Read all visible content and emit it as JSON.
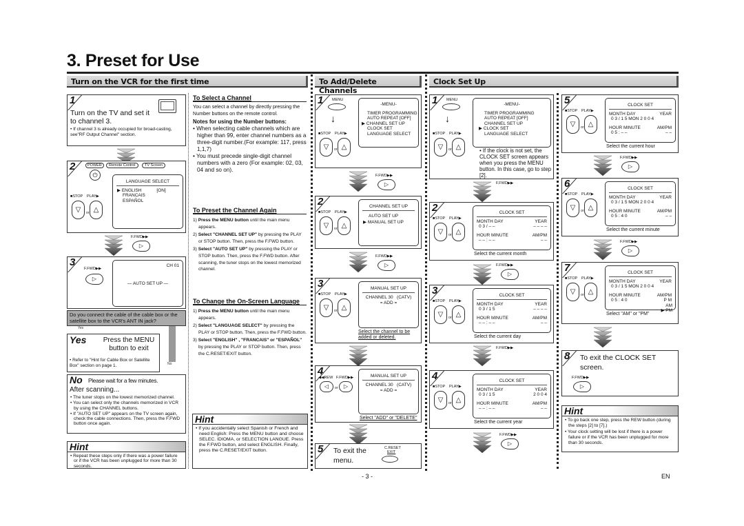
{
  "page": {
    "title": "3. Preset for Use",
    "page_number": "- 3 -",
    "language_code": "EN"
  },
  "sections": {
    "turn_on": "Turn on the VCR for the first time",
    "add_delete": "To Add/Delete Channels",
    "clock": "Clock Set Up"
  },
  "common": {
    "stop": "■STOP",
    "play": "PLAY▶",
    "or": "or",
    "ffwd": "F.FWD▶▶",
    "rew": "◀◀REW",
    "menu": "MENU",
    "hint": "Hint",
    "power": "POWER",
    "remote_control": "Remote Control",
    "tv_screen": "TV Screen",
    "creset": "C.RESET",
    "exit": "EXIT"
  },
  "turn_on": {
    "step1": {
      "num": "1",
      "text": "Turn on the TV and set it to channel 3.",
      "note": "• If channel 3 is already occupied for broad-casting, see\"RF Output Channel\" section."
    },
    "step2": {
      "num": "2",
      "screen_title": "LANGUAGE SELECT",
      "options": [
        "ENGLISH",
        "FRANCAIS",
        "ESPAÑOL"
      ],
      "option_state": "[ON]"
    },
    "step3": {
      "num": "3",
      "channel": "CH 01",
      "screen_text": "AUTO SET UP"
    },
    "question": "Do you connect the cable of the cable box or the satellite box to the VCR's ANT IN jack?",
    "yes_label": "Yes",
    "no_label": "No",
    "yes_head": "Yes",
    "yes_text": "Press the MENU button to exit",
    "yes_note": "• Refer to \"Hint for Cable Box or Satellite Box\" section on page 1.",
    "no_head": "No",
    "no_text": "Please wait for a few minutes.",
    "after": "After scanning...",
    "after_bullets": [
      "• The tuner stops on the lowest memorized channel.",
      "• You can select only the channels memorized in VCR by using the CHANNEL buttons.",
      "• If \"AUTO SET UP\" appears on the TV screen again, check the cable connections. Then, press the F.FWD button once again."
    ],
    "hint_bullets": [
      "• Repeat these steps only if there was a power failure or if the VCR has been unplugged for more than 30 seconds."
    ]
  },
  "middle": {
    "select_channel": {
      "heading": "To Select a Channel",
      "intro": "You can select a channel by directly pressing the Number buttons on the remote control.",
      "notes_heading": "Notes for using the Number buttons:",
      "bullets": [
        "• When selecting cable channels which are higher than 99, enter channel numbers as a three-digit number.(For example: 117, press 1,1,7)",
        "• You must precede single-digit channel numbers with a zero (For example: 02, 03, 04 and so on)."
      ]
    },
    "preset_again": {
      "heading": "To Preset the Channel Again",
      "items": [
        {
          "n": "1)",
          "bold": "Press the MENU button",
          "rest": " until the main menu appears."
        },
        {
          "n": "2)",
          "bold": "Select \"CHANNEL SET UP\"",
          "rest": " by pressing the PLAY or STOP button. Then, press the F.FWD button."
        },
        {
          "n": "3)",
          "bold": "Select \"AUTO SET UP\"",
          "rest": " by pressing  the PLAY or STOP button. Then, press the F.FWD button. After scanning, the tuner stops on the lowest memorized channel."
        }
      ]
    },
    "change_language": {
      "heading": "To Change the On-Screen Language",
      "items": [
        {
          "n": "1)",
          "bold": "Press the MENU button",
          "rest": " until the main menu appears."
        },
        {
          "n": "2)",
          "bold": "Select \"LANGUAGE SELECT\"",
          "rest": " by pressing the PLAY or STOP button. Then, press the F.FWD button."
        },
        {
          "n": "3)",
          "bold": "Select \"ENGLISH\" , \"FRANCAIS\" or \"ESPAÑOL\"",
          "rest": " by pressing the PLAY or STOP button. Then, press the C.RESET/EXIT button."
        }
      ]
    },
    "hint_bullets": [
      "• If you accidentally select Spanish or French and need English: Press the MENU button and choose SELEC. IDIOMA, or SELECTION LANGUE.  Press the F.FWD button, and select ENGLISH. Finally, press the C.RESET/EXIT button."
    ]
  },
  "menu_screen": {
    "title": "-MENU-",
    "items": [
      "TIMER PROGRAMMING",
      "AUTO REPEAT  [OFF]",
      "CHANNEL SET UP",
      "CLOCK SET",
      "LANGUAGE SELECT"
    ]
  },
  "add_delete": {
    "step1": {
      "num": "1",
      "selected_index": 2
    },
    "step2": {
      "num": "2",
      "screen_title": "CHANNEL SET UP",
      "items": [
        "AUTO SET UP",
        "MANUAL SET UP"
      ],
      "selected_index": 1
    },
    "step3": {
      "num": "3",
      "screen_title": "MANUAL SET UP",
      "channel_label": "CHANNEL",
      "channel": "30",
      "type": "(CATV)",
      "state": "ADD",
      "caption": "Select the channel to be added or deleted."
    },
    "step4": {
      "num": "4",
      "screen_title": "MANUAL SET UP",
      "channel_label": "CHANNEL",
      "channel": "30",
      "type": "(CATV)",
      "state": "ADD",
      "caption": "Select \"ADD\" or \"DELETE\""
    },
    "step5": {
      "num": "5",
      "text": "To exit the menu."
    }
  },
  "clock": {
    "labels": {
      "title": "CLOCK SET",
      "month": "MONTH",
      "day": "DAY",
      "year": "YEAR",
      "hour": "HOUR",
      "minute": "MINUTE",
      "ampm": "AM/PM"
    },
    "step1": {
      "num": "1",
      "selected_index": 3,
      "note": "• If the clock is not set, the CLOCK SET screen appears when you press the MENU button. In this case, go to step [2]."
    },
    "step2": {
      "num": "2",
      "date": "0 3   /   – –",
      "year": "– – – –",
      "time": "– –   :   – –",
      "ampm": "– –",
      "caption": "Select the current month"
    },
    "step3": {
      "num": "3",
      "date": "0 3   /   1 5",
      "year": "– – – –",
      "time": "– –   :   – –",
      "ampm": "– –",
      "caption": "Select the current day"
    },
    "step4": {
      "num": "4",
      "date": "0 3   /   1 5",
      "year": "2 0 0 4",
      "time": "– –   :   – –",
      "ampm": "– –",
      "caption": "Select the current year"
    },
    "step5": {
      "num": "5",
      "date": "0 3   /   1 5  MON  2 0 0 4",
      "time": "0 5   :   – –",
      "ampm": "– –",
      "caption": "Select the current hour"
    },
    "step6": {
      "num": "6",
      "date": "0 3   /   1 5  MON  2 0 0 4",
      "time": "0 5   :   4 0",
      "ampm": "– –",
      "caption": "Select the current minute"
    },
    "step7": {
      "num": "7",
      "date": "0 3   /   1 5  MON 2 0 0 4",
      "time": "0 5   :   4 0",
      "ampm": "P M",
      "ampm_options": [
        "AM",
        "PM"
      ],
      "caption": "Select \"AM\" or \"PM\""
    },
    "step8": {
      "num": "8",
      "text": "To exit the CLOCK SET screen."
    },
    "hint_bullets": [
      "• To go back one step, press the REW button (during the steps [2] to [7].)",
      "• Your clock setting will be lost if there is a power failure or if the VCR has been unplugged for more than 30 seconds."
    ]
  }
}
